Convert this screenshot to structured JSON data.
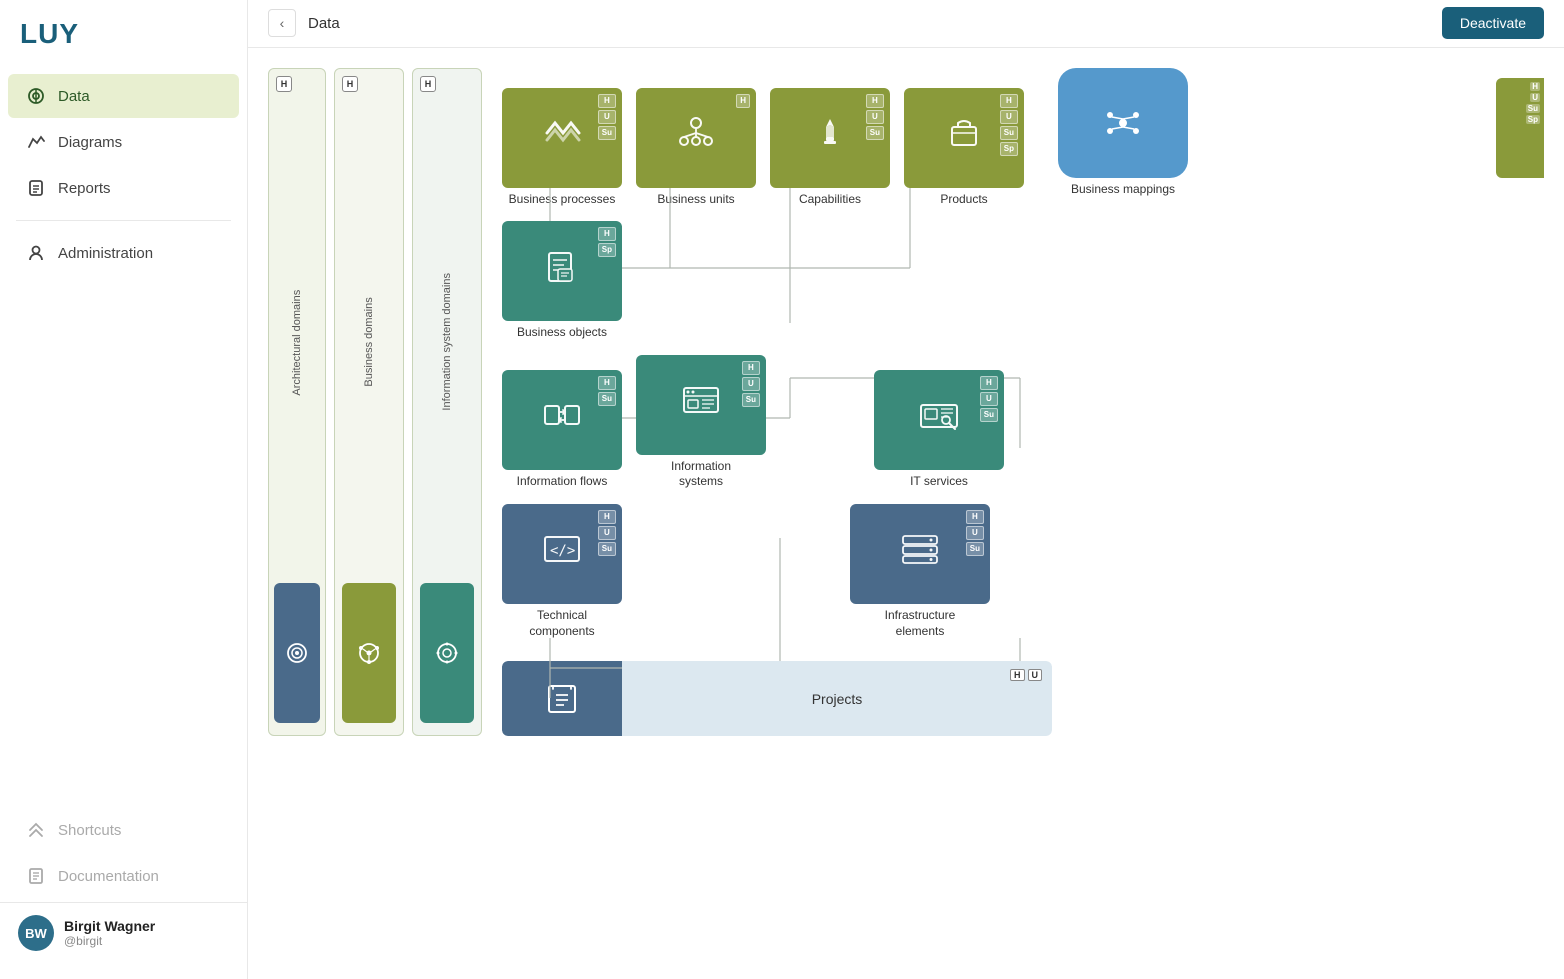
{
  "app": {
    "logo": "LUY",
    "page_title": "Data",
    "deactivate_label": "Deactivate"
  },
  "sidebar": {
    "items": [
      {
        "id": "data",
        "label": "Data",
        "icon": "data-icon",
        "active": true
      },
      {
        "id": "diagrams",
        "label": "Diagrams",
        "icon": "diagrams-icon",
        "active": false
      },
      {
        "id": "reports",
        "label": "Reports",
        "icon": "reports-icon",
        "active": false
      }
    ],
    "secondary_items": [
      {
        "id": "administration",
        "label": "Administration",
        "icon": "admin-icon"
      }
    ],
    "bottom_items": [
      {
        "id": "shortcuts",
        "label": "Shortcuts",
        "icon": "shortcuts-icon",
        "disabled": true
      },
      {
        "id": "documentation",
        "label": "Documentation",
        "icon": "docs-icon",
        "disabled": true
      }
    ],
    "user": {
      "initials": "BW",
      "name": "Birgit Wagner",
      "handle": "@birgit"
    }
  },
  "diagram": {
    "lanes": [
      {
        "id": "arch",
        "label": "Architectural domains",
        "badge": "H"
      },
      {
        "id": "biz",
        "label": "Business domains",
        "badge": "H"
      },
      {
        "id": "info",
        "label": "Information system domains",
        "badge": "H"
      }
    ],
    "nodes": {
      "top_row": [
        {
          "id": "business_processes",
          "label": "Business processes",
          "color": "olive",
          "badges": [
            "H",
            "U",
            "Su"
          ],
          "icon": "▶▶"
        },
        {
          "id": "business_units",
          "label": "Business units",
          "color": "olive",
          "badges": [
            "H"
          ],
          "icon": "👥"
        },
        {
          "id": "capabilities",
          "label": "Capabilities",
          "color": "olive",
          "badges": [
            "H",
            "U",
            "Su"
          ],
          "icon": "♟"
        },
        {
          "id": "products",
          "label": "Products",
          "color": "olive",
          "badges": [
            "H",
            "U",
            "Su",
            "Sp"
          ],
          "icon": "📦"
        }
      ],
      "middle": [
        {
          "id": "business_mappings",
          "label": "Business mappings",
          "color": "blue-pill",
          "icon": "⬡"
        },
        {
          "id": "business_objects",
          "label": "Business objects",
          "color": "teal",
          "badges": [
            "H",
            "Sp"
          ],
          "icon": "📄"
        },
        {
          "id": "information_flows",
          "label": "Information flows",
          "color": "teal",
          "badges": [
            "H",
            "Su"
          ],
          "icon": "⇄"
        },
        {
          "id": "information_systems",
          "label": "Information systems",
          "color": "teal",
          "badges": [
            "H",
            "U",
            "Su"
          ],
          "icon": "🖥"
        },
        {
          "id": "it_services",
          "label": "IT services",
          "color": "teal",
          "badges": [
            "H",
            "U",
            "Su"
          ],
          "icon": "🖨"
        }
      ],
      "bottom_row": [
        {
          "id": "technical_components",
          "label": "Technical components",
          "color": "steel",
          "badges": [
            "H",
            "U",
            "Su"
          ],
          "icon": "</>"
        },
        {
          "id": "infrastructure_elements",
          "label": "Infrastructure elements",
          "color": "steel",
          "badges": [
            "H",
            "U",
            "Su"
          ],
          "icon": "⊞"
        }
      ],
      "projects": {
        "id": "projects",
        "label": "Projects",
        "color": "steel",
        "badges": [
          "H",
          "U"
        ],
        "icon": "📋"
      },
      "lane_blocks": [
        {
          "id": "arch_block",
          "color": "steel",
          "icon": "⊙"
        },
        {
          "id": "biz_block_olive",
          "color": "olive",
          "icon": "✿"
        },
        {
          "id": "info_block_teal",
          "color": "teal",
          "icon": "📀"
        }
      ]
    }
  }
}
